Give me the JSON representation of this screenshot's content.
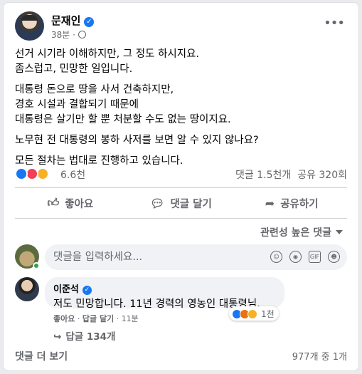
{
  "post": {
    "author": "문재인",
    "time": "38분",
    "paragraphs": [
      [
        "선거 시기라 이해하지만, 그 정도 하시지요.",
        "좀스럽고, 민망한 일입니다."
      ],
      [
        "대통령 돈으로 땅을 사서 건축하지만,",
        "경호 시설과 결합되기 때문에",
        "대통령은 살기만 할 뿐 처분할 수도 없는 땅이지요."
      ],
      [
        "노무현 전 대통령의 봉하 사저를 보면 알 수 있지 않나요?"
      ],
      [
        "모든 절차는 법대로 진행하고 있습니다."
      ]
    ]
  },
  "reactions": {
    "count": "6.6천",
    "comments": "댓글 1.5천개",
    "shares": "공유 320회",
    "colors": {
      "like": "#1877f2",
      "love": "#f33e58",
      "care": "#f7b125"
    }
  },
  "actions": {
    "like": "좋아요",
    "comment": "댓글 달기",
    "share": "공유하기"
  },
  "sort_label": "관련성 높은 댓글",
  "composer": {
    "placeholder": "댓글을 입력하세요...",
    "icons": [
      "emoji-icon",
      "camera-icon",
      "gif-icon",
      "sticker-icon"
    ]
  },
  "comment": {
    "author": "이준석",
    "text": "저도 민망합니다. 11년 경력의 영농인 대통령님.",
    "reaction_count": "1천",
    "like": "좋아요",
    "reply": "답글 달기",
    "time": "11분",
    "replies": "답글 134개"
  },
  "footer": {
    "more_comments": "댓글 더 보기",
    "total": "977개 중 1개"
  }
}
